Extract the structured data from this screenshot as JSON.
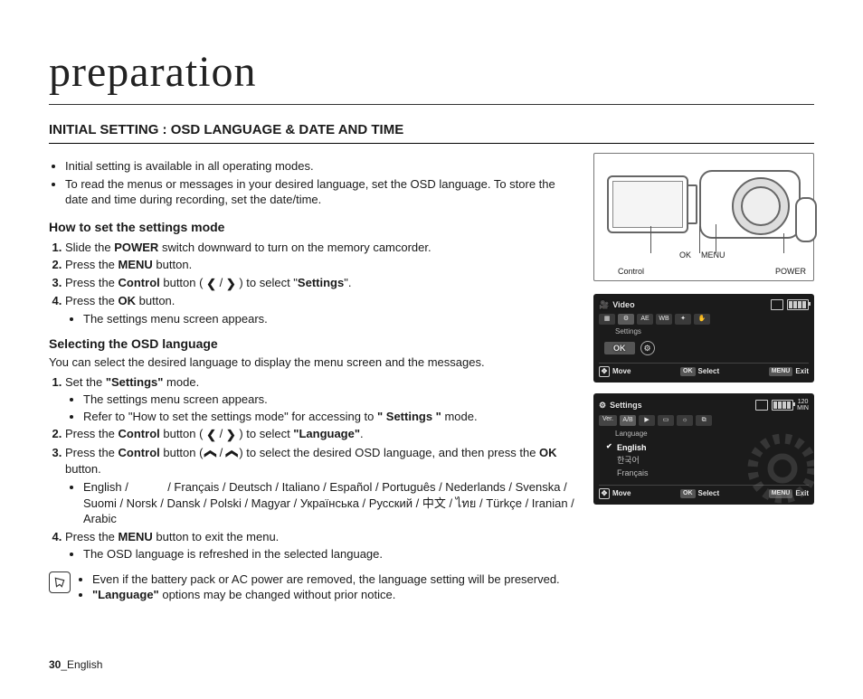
{
  "chapter_title": "preparation",
  "section_title": "INITIAL SETTING : OSD LANGUAGE & DATE AND TIME",
  "intro_bullets": [
    "Initial setting is available in all operating modes.",
    "To read the menus or messages in your desired language, set the OSD language. To store the date and time during recording, set the date/time."
  ],
  "how_to_heading": "How to set the settings mode",
  "steps_a": {
    "s1_pre": "Slide the ",
    "s1_b": "POWER",
    "s1_post": " switch downward to turn on the memory camcorder.",
    "s2_pre": "Press the ",
    "s2_b": "MENU",
    "s2_post": " button.",
    "s3_pre": "Press the ",
    "s3_b": "Control",
    "s3_mid1": " button ( ",
    "s3_arrow_l": "❮",
    "s3_sep": " / ",
    "s3_arrow_r": "❯",
    "s3_mid2": " ) to select \"",
    "s3_b2": "Settings",
    "s3_post": "\".",
    "s4_pre": "Press the ",
    "s4_b": "OK",
    "s4_post": " button.",
    "s4_sub": "The settings menu screen appears."
  },
  "osd_heading": "Selecting the OSD language",
  "osd_intro": "You can select the desired language to display the menu screen and the messages.",
  "steps_b": {
    "s1_pre": "Set the ",
    "s1_b": "\"Settings\"",
    "s1_post": " mode.",
    "s1_sub1": "The settings menu screen appears.",
    "s1_sub2_pre": "Refer to \"How to set the settings mode\" for accessing to ",
    "s1_sub2_b": "\" Settings \"",
    "s1_sub2_post": " mode.",
    "s2_pre": "Press the ",
    "s2_b": "Control",
    "s2_mid1": " button ( ",
    "s2_arrow_l": "❮",
    "s2_sep": " / ",
    "s2_arrow_r": "❯",
    "s2_mid2": " ) to select ",
    "s2_b2": "\"Language\"",
    "s2_post": ".",
    "s3_pre": "Press the ",
    "s3_b": "Control",
    "s3_mid1": " button ( ",
    "s3_arrow_u": "❮",
    "s3_sep": " / ",
    "s3_arrow_d": "❯",
    "s3_mid2": " ) to select the desired OSD language, and then press the ",
    "s3_b2": "OK",
    "s3_post": " button.",
    "s3_sub_langs": "English /            / Français / Deutsch / Italiano / Español / Português / Nederlands / Svenska / Suomi / Norsk / Dansk / Polski / Magyar / Українська / Русский / 中文 / ไทย / Türkçe / Iranian / Arabic",
    "s4_pre": "Press the ",
    "s4_b": "MENU",
    "s4_post": " button to exit the menu.",
    "s4_sub": "The OSD language is refreshed in the selected language."
  },
  "note": {
    "n1": "Even if the battery pack or AC power are removed, the language setting will be preserved.",
    "n2_b": "\"Language\"",
    "n2_post": " options may be changed without prior notice."
  },
  "footer_page": "30",
  "footer_lang": "_English",
  "cam": {
    "ok": "OK",
    "menu": "MENU",
    "control": "Control",
    "power": "POWER"
  },
  "lcd1": {
    "mode_icon": "🎥",
    "mode": "Video",
    "settings_label": "Settings",
    "ok": "OK",
    "move": "Move",
    "select": "Select",
    "exit": "Exit",
    "ok_tag": "OK",
    "menu_tag": "MENU",
    "icons": {
      "ae": "AE",
      "wb": "WB"
    }
  },
  "lcd2": {
    "gear": "⚙",
    "title": "Settings",
    "ver": "Ver.",
    "ab": "A/B",
    "group_label": "Language",
    "items": [
      "English",
      "한국어",
      "Français"
    ],
    "selected_index": 0,
    "move": "Move",
    "select": "Select",
    "exit": "Exit",
    "ok_tag": "OK",
    "menu_tag": "MENU",
    "time": "120",
    "time_unit": "MIN"
  }
}
